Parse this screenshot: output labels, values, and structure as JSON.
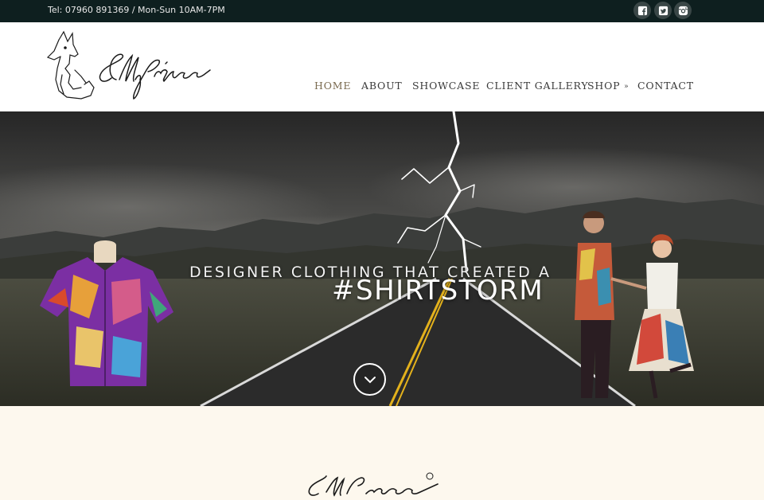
{
  "topbar": {
    "contact": "Tel: 07960 891369 / Mon-Sun 10AM-7PM",
    "social": [
      "facebook-icon",
      "twitter-icon",
      "instagram-icon"
    ]
  },
  "header": {
    "logo_text": "Elly Prizeman",
    "nav": [
      {
        "label": "HOME",
        "active": true
      },
      {
        "label": "ABOUT"
      },
      {
        "label": "SHOWCASE"
      },
      {
        "label": "CLIENT GALLERY"
      },
      {
        "label": "SHOP"
      },
      {
        "label": "CONTACT"
      }
    ]
  },
  "hero": {
    "tagline": "DESIGNER CLOTHING THAT CREATED A",
    "headline": "#SHIRTSTORM"
  },
  "bottom": {
    "logo_text": "Elly Prizeman"
  },
  "colors": {
    "topbar": "#0e1f1f",
    "nav_active": "#7a6a4f",
    "cream": "#fdf8ee"
  }
}
